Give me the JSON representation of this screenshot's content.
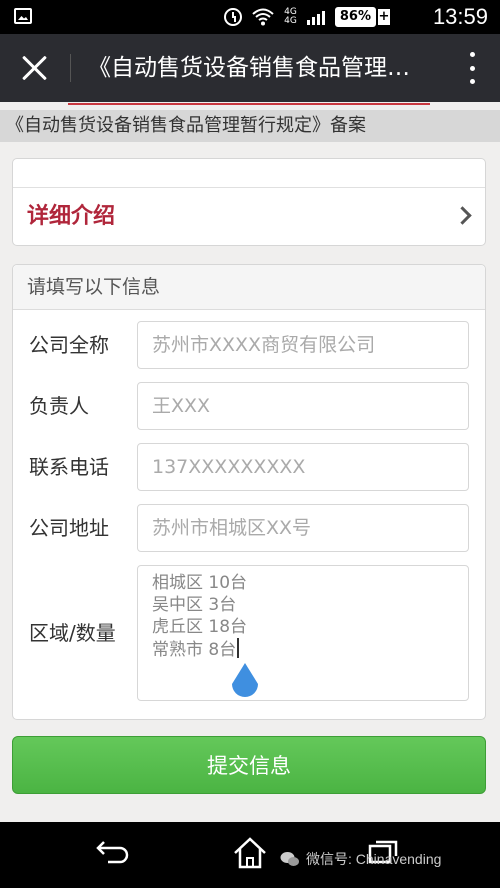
{
  "status_bar": {
    "network": "4G",
    "network2": "4G",
    "battery": "86%",
    "time": "13:59"
  },
  "title_bar": {
    "title": "《自动售货设备销售食品管理暂行规定》备案"
  },
  "banner": {
    "text": "《自动售货设备销售食品管理暂行规定》备案"
  },
  "detail": {
    "label": "详细介绍"
  },
  "form": {
    "header": "请填写以下信息",
    "fields": [
      {
        "label": "公司全称",
        "placeholder": "苏州市XXXX商贸有限公司"
      },
      {
        "label": "负责人",
        "placeholder": "王XXX"
      },
      {
        "label": "联系电话",
        "placeholder": "137XXXXXXXXX"
      },
      {
        "label": "公司地址",
        "placeholder": "苏州市相城区XX号"
      }
    ],
    "region": {
      "label": "区域/数量",
      "lines": [
        "相城区 10台",
        "吴中区 3台",
        "虎丘区 18台",
        "常熟市 8台"
      ]
    },
    "submit_label": "提交信息"
  },
  "watermark": {
    "text": "微信号: Chinavending"
  },
  "colors": {
    "accent_red": "#b0263b",
    "submit_green": "#4bb443",
    "title_bar": "#2b2c31"
  }
}
